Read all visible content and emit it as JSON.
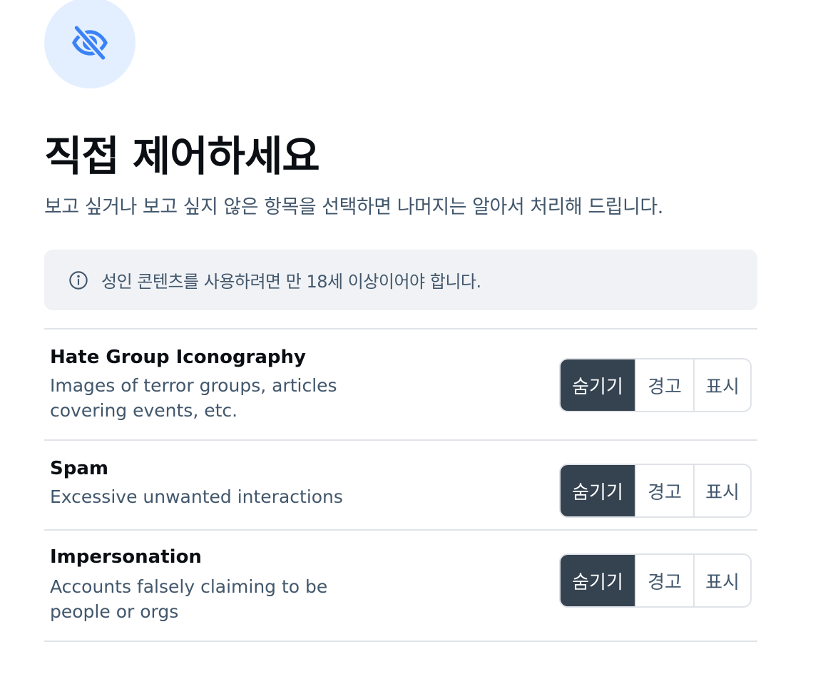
{
  "hero": {
    "icon": "eye-slash-icon",
    "accent_color": "#3b82f6",
    "background": "#e3efff"
  },
  "title": "직접 제어하세요",
  "subtitle": "보고 싶거나 보고 싶지 않은 항목을 선택하면 나머지는 알아서 처리해 드립니다.",
  "notice": {
    "icon": "info-circle-icon",
    "text": "성인 콘텐츠를 사용하려면 만 18세 이상이어야 합니다."
  },
  "filters": [
    {
      "title": "Hate Group Iconography",
      "description": "Images of terror groups, articles covering events, etc.",
      "options": [
        "숨기기",
        "경고",
        "표시"
      ],
      "selected": "숨기기"
    },
    {
      "title": "Spam",
      "description": "Excessive unwanted interactions",
      "options": [
        "숨기기",
        "경고",
        "표시"
      ],
      "selected": "숨기기"
    },
    {
      "title": "Impersonation",
      "description": "Accounts falsely claiming to be people or orgs",
      "options": [
        "숨기기",
        "경고",
        "표시"
      ],
      "selected": "숨기기"
    }
  ],
  "colors": {
    "selected_bg": "#354250",
    "muted_text": "#42576c",
    "notice_bg": "#f0f2f5",
    "divider": "#e0e4e9"
  }
}
